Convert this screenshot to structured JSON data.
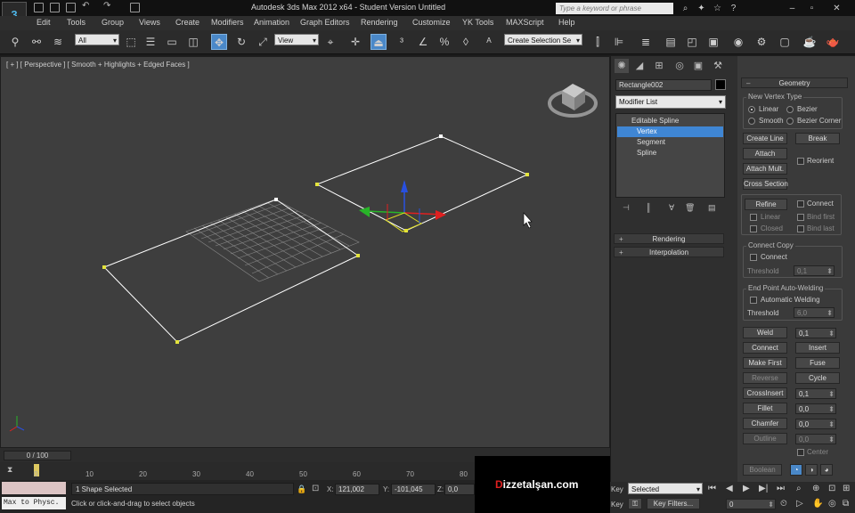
{
  "window": {
    "title": "Autodesk 3ds Max  2012 x64   - Student Version    Untitled",
    "search_placeholder": "Type a keyword or phrase",
    "logo_text": "3"
  },
  "menu": [
    "Edit",
    "Tools",
    "Group",
    "Views",
    "Create",
    "Modifiers",
    "Animation",
    "Graph Editors",
    "Rendering",
    "Customize",
    "YK Tools",
    "MAXScript",
    "Help"
  ],
  "toolbar": {
    "selection_filter": "All",
    "ref_coord": "View",
    "named_selection": "Create Selection Se"
  },
  "viewport": {
    "label": "[ + ] [ Perspective ] [ Smooth + Highlights + Edged Faces ]",
    "background": "#3e3e3e",
    "spline_color": "#ffffff",
    "vertex_color": "#e4e43c"
  },
  "command_panel": {
    "object_name": "Rectangle002",
    "object_color": "#000000",
    "modifier_list": "Modifier List",
    "stack": {
      "top": "Editable Spline",
      "items": [
        "Vertex",
        "Segment",
        "Spline"
      ],
      "selected": "Vertex"
    },
    "rollouts": [
      "Rendering",
      "Interpolation"
    ]
  },
  "geometry": {
    "title": "Geometry",
    "new_vertex_type": {
      "label": "New Vertex Type",
      "options": [
        "Linear",
        "Bezier",
        "Smooth",
        "Bezier Corner"
      ],
      "selected": "Linear"
    },
    "create_line": "Create Line",
    "break": "Break",
    "attach": "Attach",
    "reorient": "Reorient",
    "attach_mult": "Attach Mult.",
    "cross_section": "Cross Section",
    "refine": "Refine",
    "connect": "Connect",
    "linear": "Linear",
    "bind_first": "Bind first",
    "closed": "Closed",
    "bind_last": "Bind last",
    "connect_copy": {
      "label": "Connect Copy",
      "connect": "Connect",
      "threshold_label": "Threshold",
      "threshold_value": "0,1"
    },
    "auto_weld": {
      "label": "End Point Auto-Welding",
      "automatic": "Automatic Welding",
      "threshold_label": "Threshold",
      "threshold_value": "6,0"
    },
    "weld": "Weld",
    "weld_value": "0,1",
    "connect_btn": "Connect",
    "insert": "Insert",
    "make_first": "Make First",
    "fuse": "Fuse",
    "reverse": "Reverse",
    "cycle": "Cycle",
    "cross_insert": "CrossInsert",
    "cross_insert_value": "0,1",
    "fillet": "Fillet",
    "fillet_value": "0,0",
    "chamfer": "Chamfer",
    "chamfer_value": "0,0",
    "outline": "Outline",
    "outline_value": "0,0",
    "center": "Center",
    "boolean": "Boolean"
  },
  "timeline": {
    "slider": "0 / 100",
    "ticks": [
      "0",
      "10",
      "20",
      "30",
      "40",
      "50",
      "60",
      "70",
      "80"
    ]
  },
  "status": {
    "maxscript": "Max to Physc.",
    "selection": "1 Shape Selected",
    "prompt": "Click or click-and-drag to select objects",
    "x_label": "X:",
    "x": "121,002",
    "y_label": "Y:",
    "y": "-101,045",
    "z_label": "Z:",
    "z": "0,0"
  },
  "watermark": {
    "prefix": "D",
    "text": "izzetalşan.com"
  },
  "animation": {
    "key_label": "Key",
    "key_mode": "Selected",
    "key_filters": "Key Filters...",
    "frame": "0"
  }
}
